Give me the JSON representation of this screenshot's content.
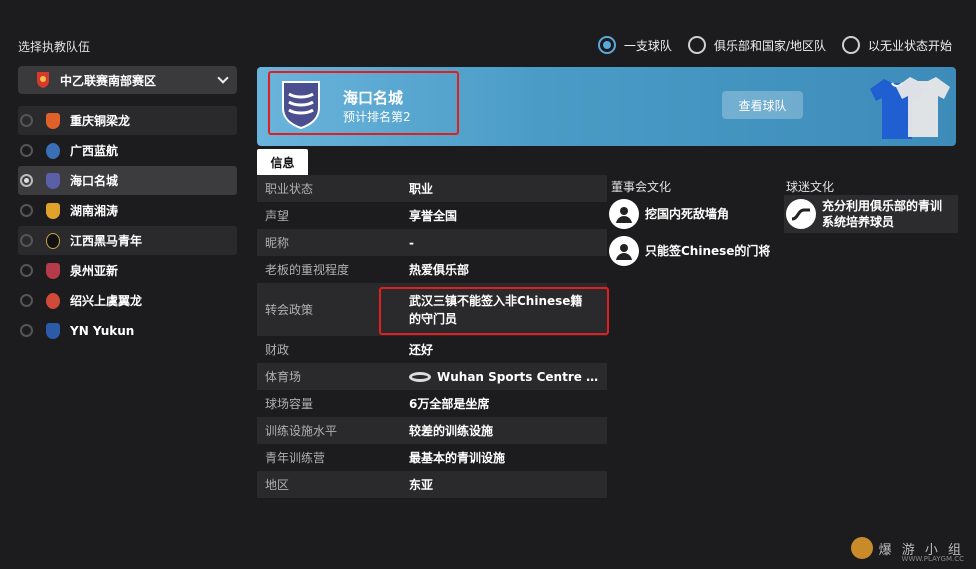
{
  "left_panel": {
    "title": "选择执教队伍",
    "league_dropdown": {
      "selected": "中乙联赛南部赛区"
    },
    "teams": [
      {
        "name": "重庆铜梁龙",
        "color": "#e0602a",
        "selected": false
      },
      {
        "name": "广西蓝航",
        "color": "#3a6fb5",
        "selected": false
      },
      {
        "name": "海口名城",
        "color": "#5a5fa8",
        "selected": true
      },
      {
        "name": "湖南湘涛",
        "color": "#e0a22a",
        "selected": false
      },
      {
        "name": "江西黑马青年",
        "color": "#222222",
        "selected": false
      },
      {
        "name": "泉州亚新",
        "color": "#b53a4a",
        "selected": false
      },
      {
        "name": "绍兴上虞翼龙",
        "color": "#d04a3a",
        "selected": false
      },
      {
        "name": "YN Yukun",
        "color": "#2a5aa8",
        "selected": false
      }
    ]
  },
  "mode_options": [
    {
      "label": "一支球队",
      "selected": true
    },
    {
      "label": "俱乐部和国家/地区队",
      "selected": false
    },
    {
      "label": "以无业状态开始",
      "selected": false
    }
  ],
  "banner": {
    "team_name": "海口名城",
    "ranking": "预计排名第2",
    "view_button": "查看球队"
  },
  "tabs": {
    "info": "信息"
  },
  "info_rows": [
    {
      "key": "职业状态",
      "value": "职业"
    },
    {
      "key": "声望",
      "value": "享誉全国"
    },
    {
      "key": "昵称",
      "value": "-"
    },
    {
      "key": "老板的重视程度",
      "value": "热爱俱乐部"
    },
    {
      "key": "转会政策",
      "value": "武汉三镇不能签入非Chinese籍的守门员"
    },
    {
      "key": "财政",
      "value": "还好"
    },
    {
      "key": "体育场",
      "value": "Wuhan Sports Centre Sta..."
    },
    {
      "key": "球场容量",
      "value": "6万全部是坐席"
    },
    {
      "key": "训练设施水平",
      "value": "较差的训练设施"
    },
    {
      "key": "青年训练营",
      "value": "最基本的青训设施"
    },
    {
      "key": "地区",
      "value": "东亚"
    }
  ],
  "board_culture": {
    "title": "董事会文化",
    "items": [
      "挖国内死敌墙角",
      "只能签Chinese的门将"
    ]
  },
  "fan_culture": {
    "title": "球迷文化",
    "items": [
      "充分利用俱乐部的青训系统培养球员"
    ]
  },
  "watermark": {
    "text": "爆 游 小 组",
    "url": "WWW.PLAYGM.CC"
  },
  "colors": {
    "accent": "#5aa9d6",
    "banner": "#4a9cc7",
    "highlight": "#e02020"
  }
}
